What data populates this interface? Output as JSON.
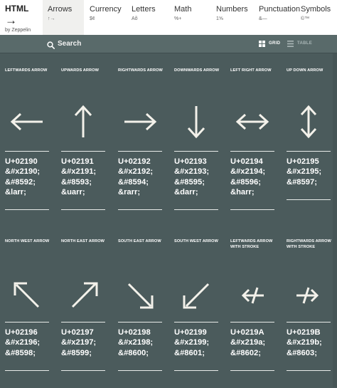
{
  "brand": {
    "title": "HTML",
    "arrow": "→",
    "byline": "by Zeppelin"
  },
  "nav": [
    {
      "label": "Arrows",
      "sample": "↑→",
      "active": true
    },
    {
      "label": "Currency",
      "sample": "$¢",
      "active": false
    },
    {
      "label": "Letters",
      "sample": "Aõ",
      "active": false
    },
    {
      "label": "Math",
      "sample": "%+",
      "active": false
    },
    {
      "label": "Numbers",
      "sample": "1⅝",
      "active": false
    },
    {
      "label": "Punctuation",
      "sample": "&—",
      "active": false
    },
    {
      "label": "Symbols",
      "sample": "©™",
      "active": false
    }
  ],
  "toolbar": {
    "search_label": "Search",
    "grid_label": "GRID",
    "table_label": "TABLE"
  },
  "colors": {
    "background": "#4b5b5c",
    "searchbar": "#596a6a",
    "text": "#ffffff",
    "rule": "#e9ecea"
  },
  "cards": [
    {
      "name": "LEFTWARDS ARROW",
      "code": "U+02190",
      "hex": "&#x2190;",
      "dec": "&#8592;",
      "named": "&larr;",
      "icon": "leftwards-arrow"
    },
    {
      "name": "UPWARDS ARROW",
      "code": "U+02191",
      "hex": "&#x2191;",
      "dec": "&#8593;",
      "named": "&uarr;",
      "icon": "upwards-arrow"
    },
    {
      "name": "RIGHTWARDS ARROW",
      "code": "U+02192",
      "hex": "&#x2192;",
      "dec": "&#8594;",
      "named": "&rarr;",
      "icon": "rightwards-arrow"
    },
    {
      "name": "DOWNWARDS ARROW",
      "code": "U+02193",
      "hex": "&#x2193;",
      "dec": "&#8595;",
      "named": "&darr;",
      "icon": "downwards-arrow"
    },
    {
      "name": "LEFT RIGHT ARROW",
      "code": "U+02194",
      "hex": "&#x2194;",
      "dec": "&#8596;",
      "named": "&harr;",
      "icon": "left-right-arrow"
    },
    {
      "name": "UP DOWN ARROW",
      "code": "U+02195",
      "hex": "&#x2195;",
      "dec": "&#8597;",
      "named": "",
      "icon": "up-down-arrow"
    },
    {
      "name": "NORTH WEST ARROW",
      "code": "U+02196",
      "hex": "&#x2196;",
      "dec": "&#8598;",
      "named": "",
      "icon": "north-west-arrow"
    },
    {
      "name": "NORTH EAST ARROW",
      "code": "U+02197",
      "hex": "&#x2197;",
      "dec": "&#8599;",
      "named": "",
      "icon": "north-east-arrow"
    },
    {
      "name": "SOUTH EAST ARROW",
      "code": "U+02198",
      "hex": "&#x2198;",
      "dec": "&#8600;",
      "named": "",
      "icon": "south-east-arrow"
    },
    {
      "name": "SOUTH WEST ARROW",
      "code": "U+02199",
      "hex": "&#x2199;",
      "dec": "&#8601;",
      "named": "",
      "icon": "south-west-arrow"
    },
    {
      "name": "LEFTWARDS ARROW WITH STROKE",
      "code": "U+0219A",
      "hex": "&#x219a;",
      "dec": "&#8602;",
      "named": "",
      "icon": "leftwards-arrow-with-stroke"
    },
    {
      "name": "RIGHTWARDS ARROW WITH STROKE",
      "code": "U+0219B",
      "hex": "&#x219b;",
      "dec": "&#8603;",
      "named": "",
      "icon": "rightwards-arrow-with-stroke"
    }
  ]
}
